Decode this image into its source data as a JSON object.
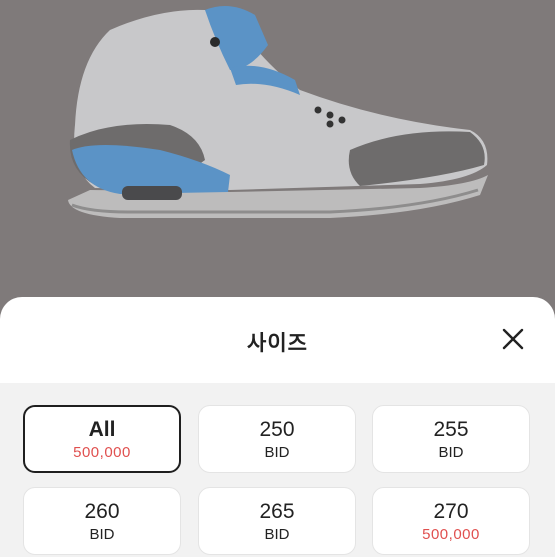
{
  "sheet": {
    "title": "사이즈",
    "close_icon": "close-icon"
  },
  "sizes": [
    {
      "label": "All",
      "sub": "500,000",
      "sub_type": "price",
      "selected": true
    },
    {
      "label": "250",
      "sub": "BID",
      "sub_type": "bid",
      "selected": false
    },
    {
      "label": "255",
      "sub": "BID",
      "sub_type": "bid",
      "selected": false
    },
    {
      "label": "260",
      "sub": "BID",
      "sub_type": "bid",
      "selected": false
    },
    {
      "label": "265",
      "sub": "BID",
      "sub_type": "bid",
      "selected": false
    },
    {
      "label": "270",
      "sub": "500,000",
      "sub_type": "price",
      "selected": false
    }
  ],
  "colors": {
    "price": "#e0504f",
    "selected_border": "#1f1f1f",
    "overlay": "#807b7b",
    "shoe_accent": "#5b93c6"
  }
}
